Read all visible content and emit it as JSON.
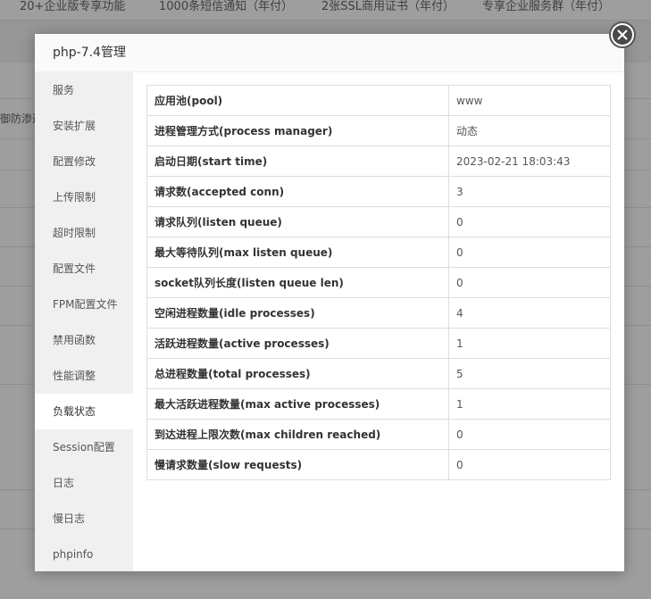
{
  "background": {
    "topbar_items": [
      "20+企业版专享功能",
      "1000条短信通知（年付）",
      "2张SSL商用证书（年付）",
      "专享企业服务群（年付）"
    ],
    "side_fragment": "御防渗透"
  },
  "modal": {
    "title": "php-7.4管理",
    "close_icon": "close-icon",
    "menu": [
      {
        "label": "服务",
        "active": false
      },
      {
        "label": "安装扩展",
        "active": false
      },
      {
        "label": "配置修改",
        "active": false
      },
      {
        "label": "上传限制",
        "active": false
      },
      {
        "label": "超时限制",
        "active": false
      },
      {
        "label": "配置文件",
        "active": false
      },
      {
        "label": "FPM配置文件",
        "active": false
      },
      {
        "label": "禁用函数",
        "active": false
      },
      {
        "label": "性能调整",
        "active": false
      },
      {
        "label": "负载状态",
        "active": true
      },
      {
        "label": "Session配置",
        "active": false
      },
      {
        "label": "日志",
        "active": false
      },
      {
        "label": "慢日志",
        "active": false
      },
      {
        "label": "phpinfo",
        "active": false
      }
    ],
    "status_rows": [
      {
        "key": "应用池(pool)",
        "value": "www"
      },
      {
        "key": "进程管理方式(process manager)",
        "value": "动态"
      },
      {
        "key": "启动日期(start time)",
        "value": "2023-02-21 18:03:43"
      },
      {
        "key": "请求数(accepted conn)",
        "value": "3"
      },
      {
        "key": "请求队列(listen queue)",
        "value": "0"
      },
      {
        "key": "最大等待队列(max listen queue)",
        "value": "0"
      },
      {
        "key": "socket队列长度(listen queue len)",
        "value": "0"
      },
      {
        "key": "空闲进程数量(idle processes)",
        "value": "4"
      },
      {
        "key": "活跃进程数量(active processes)",
        "value": "1"
      },
      {
        "key": "总进程数量(total processes)",
        "value": "5"
      },
      {
        "key": "最大活跃进程数量(max active processes)",
        "value": "1"
      },
      {
        "key": "到达进程上限次数(max children reached)",
        "value": "0"
      },
      {
        "key": "慢请求数量(slow requests)",
        "value": "0"
      }
    ]
  }
}
